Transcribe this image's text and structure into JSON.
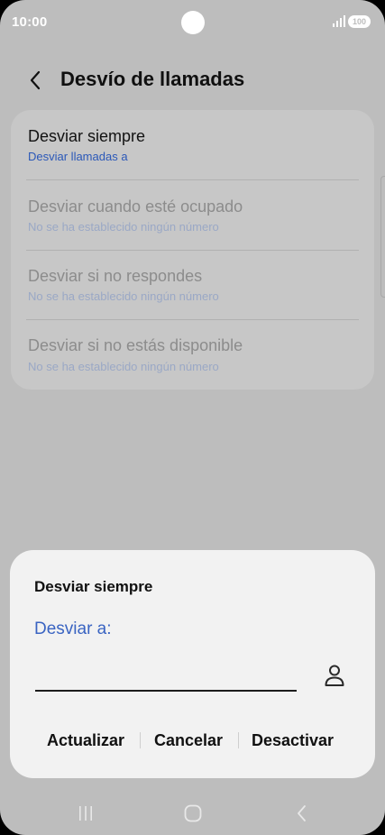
{
  "status_bar": {
    "time": "10:00",
    "battery": "100",
    "icons": [
      "signal-icon",
      "battery-icon"
    ]
  },
  "header": {
    "title": "Desvío de llamadas",
    "back_icon": "chevron-left-icon"
  },
  "settings": {
    "items": [
      {
        "title": "Desviar siempre",
        "subtitle": "Desviar llamadas a",
        "enabled": true
      },
      {
        "title": "Desviar cuando esté ocupado",
        "subtitle": "No se ha establecido ningún número",
        "enabled": false
      },
      {
        "title": "Desviar si no respondes",
        "subtitle": "No se ha establecido ningún número",
        "enabled": false
      },
      {
        "title": "Desviar si no estás disponible",
        "subtitle": "No se ha establecido ningún número",
        "enabled": false
      }
    ]
  },
  "dialog": {
    "title": "Desviar siempre",
    "field_label": "Desviar a:",
    "field_value": "",
    "contact_icon": "person-icon",
    "buttons": {
      "update": "Actualizar",
      "cancel": "Cancelar",
      "deactivate": "Desactivar"
    }
  },
  "nav_bar": {
    "icons": [
      "recents-icon",
      "home-icon",
      "back-icon"
    ]
  },
  "colors": {
    "accent": "#3a64c2",
    "scrim": "#bdbdbd",
    "dialog_bg": "#f2f2f2"
  }
}
